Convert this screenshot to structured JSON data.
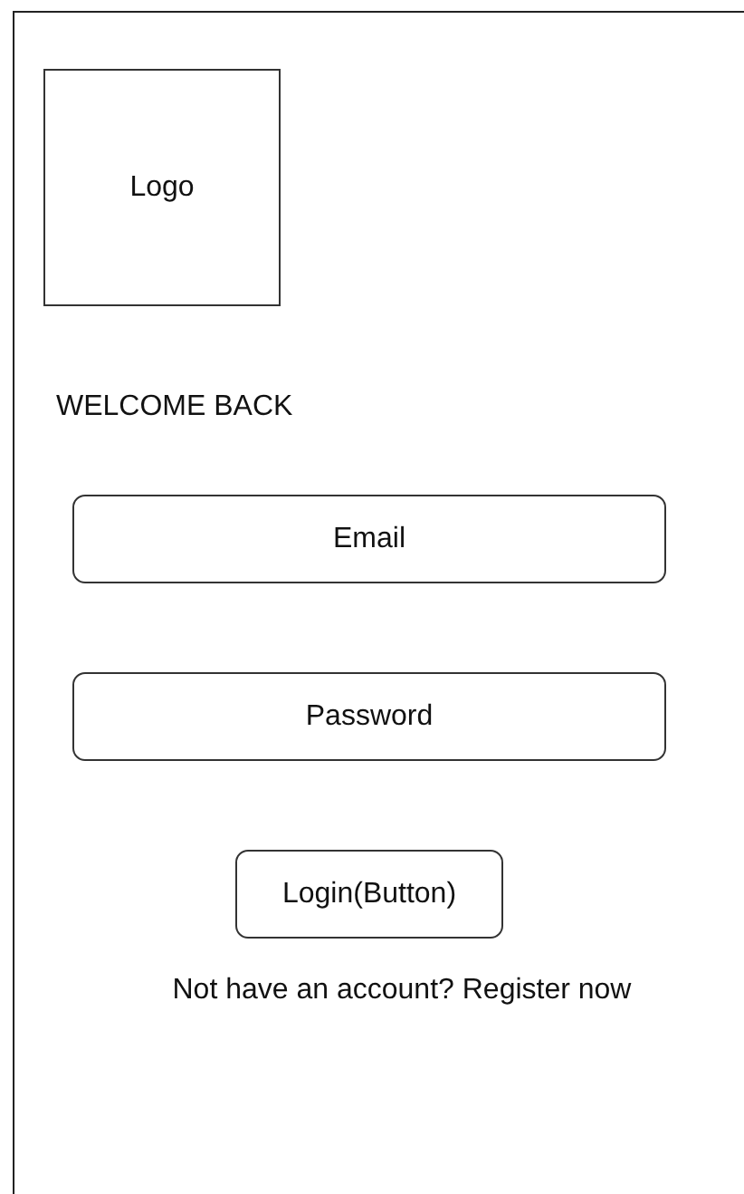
{
  "logo": {
    "label": "Logo"
  },
  "heading": "WELCOME BACK",
  "fields": [
    {
      "placeholder": "Email"
    },
    {
      "placeholder": "Password"
    }
  ],
  "login_button": "Login(Button)",
  "register_prompt": "Not have an account? Register now"
}
